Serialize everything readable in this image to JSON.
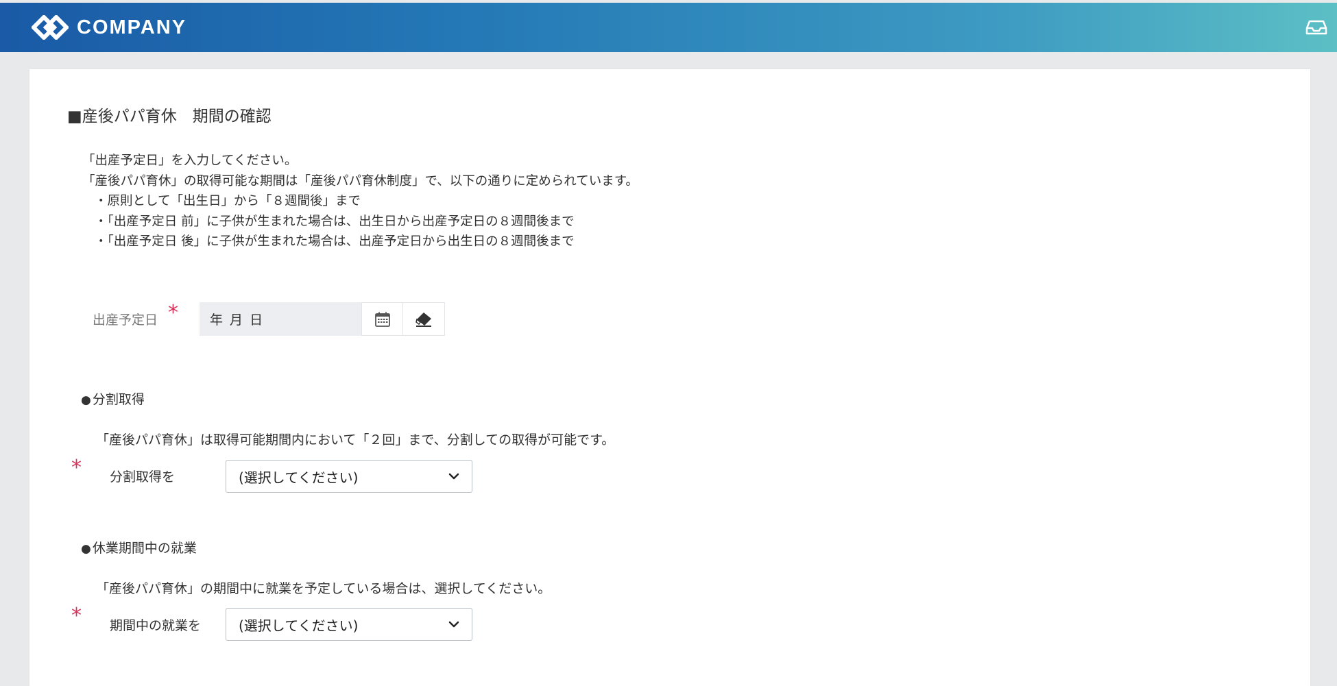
{
  "header": {
    "logo_text": "COMPANY",
    "colors": {
      "gradient_start": "#1a5aa6",
      "gradient_end": "#5cbfc5"
    },
    "right_icon": "inbox-icon"
  },
  "section": {
    "title": "■産後パパ育休　期間の確認",
    "intro_lines": [
      "「出産予定日」を入力してください。",
      "「産後パパ育休」の取得可能な期間は「産後パパ育休制度」で、以下の通りに定められています。"
    ],
    "bullets": [
      "・原則として「出生日」から「８週間後」まで",
      "・「出産予定日 前」に子供が生まれた場合は、出生日から出産予定日の８週間後まで",
      "・「出産予定日 後」に子供が生まれた場合は、出産予定日から出生日の８週間後まで"
    ]
  },
  "due_date": {
    "label": "出産予定日",
    "required_mark": "*",
    "placeholder": "年 月 日",
    "calendar_icon": "calendar-icon",
    "clear_icon": "eraser-icon"
  },
  "split": {
    "heading_dot": "●",
    "heading": "分割取得",
    "description": "「産後パパ育休」は取得可能期間内において「２回」まで、分割しての取得が可能です。",
    "required_mark": "*",
    "label": "分割取得を",
    "select_value": "(選択してください)"
  },
  "work": {
    "heading_dot": "●",
    "heading": "休業期間中の就業",
    "description": "「産後パパ育休」の期間中に就業を予定している場合は、選択してください。",
    "required_mark": "*",
    "label": "期間中の就業を",
    "select_value": "(選択してください)"
  },
  "accent_required_color": "#d8335b"
}
